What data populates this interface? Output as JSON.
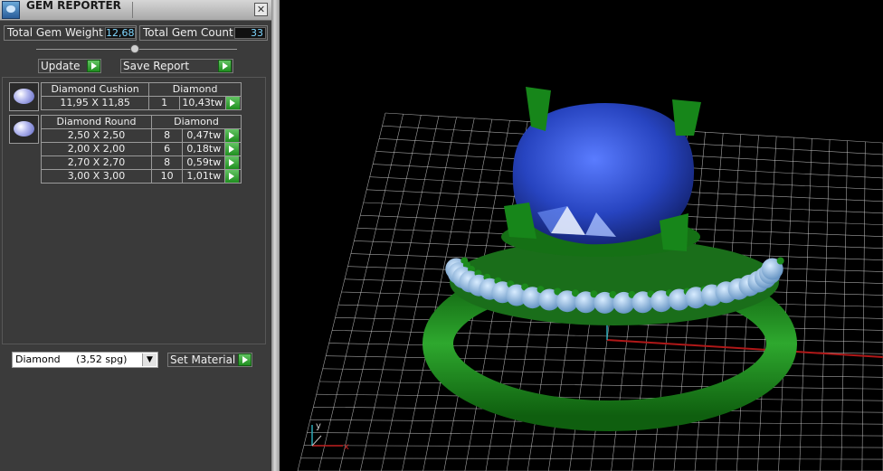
{
  "window": {
    "title": "GEM REPORTER",
    "close_label": "✕"
  },
  "stats": {
    "weight_label": "Total Gem Weight",
    "weight_value": "12,68",
    "count_label": "Total Gem Count",
    "count_value": "33"
  },
  "buttons": {
    "update": "Update",
    "save_report": "Save Report",
    "set_material": "Set Material"
  },
  "groups": [
    {
      "name": "Diamond Cushion",
      "material": "Diamond",
      "rows": [
        {
          "size": "11,95 X 11,85",
          "count": "1",
          "weight": "10,43tw"
        }
      ]
    },
    {
      "name": "Diamond Round",
      "material": "Diamond",
      "rows": [
        {
          "size": "2,50 X 2,50",
          "count": "8",
          "weight": "0,47tw"
        },
        {
          "size": "2,00 X 2,00",
          "count": "6",
          "weight": "0,18tw"
        },
        {
          "size": "2,70 X 2,70",
          "count": "8",
          "weight": "0,59tw"
        },
        {
          "size": "3,00 X 3,00",
          "count": "10",
          "weight": "1,01tw"
        }
      ]
    }
  ],
  "material_select": {
    "value": "Diamond     (3,52 spg)"
  },
  "viewport": {
    "axis_labels": {
      "x": "x",
      "y": "y"
    },
    "colors": {
      "background": "#000000",
      "grid": "#d8d8d8",
      "stone": "#2c4fc8",
      "metal": "#1f8a1f",
      "accent_stones": "#8fb6df"
    }
  }
}
